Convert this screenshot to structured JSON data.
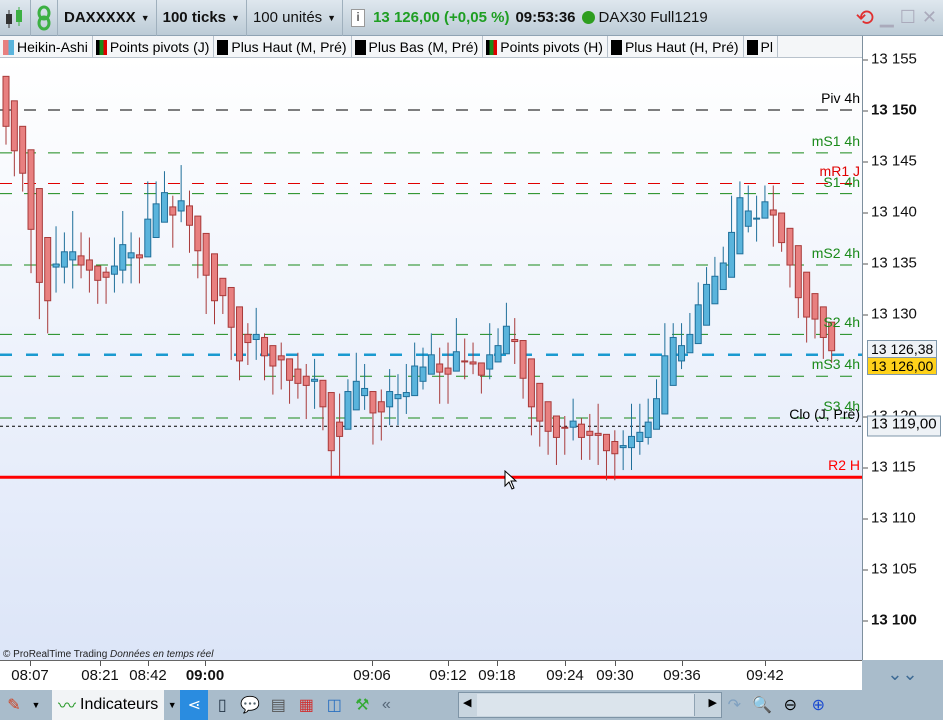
{
  "toolbar": {
    "symbol": "DAXXXXX",
    "period": "100 ticks",
    "units": "100 unités",
    "price_change": "13 126,00 (+0,05 %)",
    "time": "09:53:36",
    "feed": "DAX30 Full1219",
    "status_color": "#2e9e1f",
    "price_color": "#1e9e22"
  },
  "indicators": [
    {
      "label": "Heikin-Ashi",
      "colors": [
        "#e88080",
        "#5ab4dc"
      ]
    },
    {
      "label": "Points pivots (J)",
      "colors": [
        "#000000",
        "#1a8a1a",
        "#e00000"
      ]
    },
    {
      "label": "Plus Haut (M, Pré)",
      "colors": [
        "#000000"
      ]
    },
    {
      "label": "Plus Bas (M, Pré)",
      "colors": [
        "#000000"
      ]
    },
    {
      "label": "Points pivots (H)",
      "colors": [
        "#000000",
        "#1a8a1a",
        "#e00000"
      ]
    },
    {
      "label": "Plus Haut (H, Pré)",
      "colors": [
        "#000000"
      ]
    },
    {
      "label": "Pl",
      "colors": [
        "#000000"
      ]
    }
  ],
  "y_axis": {
    "ticks": [
      {
        "label": "13 155",
        "value": 13155,
        "bold": false
      },
      {
        "label": "13 150",
        "value": 13150,
        "bold": true
      },
      {
        "label": "13 145",
        "value": 13145,
        "bold": false
      },
      {
        "label": "13 140",
        "value": 13140,
        "bold": false
      },
      {
        "label": "13 135",
        "value": 13135,
        "bold": false
      },
      {
        "label": "13 130",
        "value": 13130,
        "bold": false
      },
      {
        "label": "13 120",
        "value": 13120,
        "bold": false
      },
      {
        "label": "13 115",
        "value": 13115,
        "bold": false
      },
      {
        "label": "13 110",
        "value": 13110,
        "bold": false
      },
      {
        "label": "13 105",
        "value": 13105,
        "bold": false
      },
      {
        "label": "13 100",
        "value": 13100,
        "bold": true
      }
    ],
    "last_price_label": "13 126,38",
    "current_price_label": "13 126,00",
    "close_label": "13 119,00"
  },
  "x_axis": {
    "ticks": [
      {
        "label": "08:07",
        "bold": false
      },
      {
        "label": "08:21",
        "bold": false
      },
      {
        "label": "08:42",
        "bold": false
      },
      {
        "label": "09:00",
        "bold": true
      },
      {
        "label": "09:06",
        "bold": false
      },
      {
        "label": "09:12",
        "bold": false
      },
      {
        "label": "09:18",
        "bold": false
      },
      {
        "label": "09:24",
        "bold": false
      },
      {
        "label": "09:30",
        "bold": false
      },
      {
        "label": "09:36",
        "bold": false
      },
      {
        "label": "09:42",
        "bold": false
      }
    ]
  },
  "levels": [
    {
      "label": "Piv 4h",
      "value": 13150,
      "color": "#000000",
      "style": "dashed"
    },
    {
      "label": "mS1 4h",
      "value": 13145.8,
      "color": "#1a8a1a",
      "style": "dashed"
    },
    {
      "label": "mR1 J",
      "value": 13142.8,
      "color": "#e00000",
      "style": "dashed"
    },
    {
      "label": "S1 4h",
      "value": 13141.8,
      "color": "#1a8a1a",
      "style": "dashed"
    },
    {
      "label": "mS2 4h",
      "value": 13134.8,
      "color": "#1a8a1a",
      "style": "dashed"
    },
    {
      "label": "S2 4h",
      "value": 13128.0,
      "color": "#1a8a1a",
      "style": "dashed"
    },
    {
      "label": "",
      "value": 13126.0,
      "color": "#1a9ad0",
      "style": "price"
    },
    {
      "label": "mS3 4h",
      "value": 13123.9,
      "color": "#1a8a1a",
      "style": "dashed"
    },
    {
      "label": "S3 4h",
      "value": 13119.8,
      "color": "#1a8a1a",
      "style": "dashed"
    },
    {
      "label": "Clo (J, Pré)",
      "value": 13119.0,
      "color": "#000000",
      "style": "dotted"
    },
    {
      "label": "R2 H",
      "value": 13114.0,
      "color": "#ff0000",
      "style": "solid"
    }
  ],
  "credit": {
    "brand": "© ProRealTime Trading",
    "note": "Données en temps réel"
  },
  "bottombar": {
    "indicators_label": "Indicateurs"
  },
  "chart_data": {
    "type": "candlestick",
    "style": "Heikin-Ashi",
    "fields": [
      "open",
      "high",
      "low",
      "close"
    ],
    "up_color": "#5ab4dc",
    "down_color": "#e88080",
    "candles": [
      [
        13153.3,
        13153.3,
        13146.6,
        13148.4
      ],
      [
        13150.9,
        13150.9,
        13143.5,
        13146.0
      ],
      [
        13148.4,
        13148.4,
        13142.0,
        13143.8
      ],
      [
        13146.1,
        13146.1,
        13134.0,
        13138.3
      ],
      [
        13142.3,
        13142.3,
        13129.5,
        13133.1
      ],
      [
        13137.5,
        13137.5,
        13128.1,
        13131.3
      ],
      [
        13134.6,
        13138.6,
        13132.1,
        13134.9
      ],
      [
        13134.6,
        13138.0,
        13133.0,
        13136.1
      ],
      [
        13135.3,
        13140.1,
        13132.5,
        13136.1
      ],
      [
        13135.7,
        13138.0,
        13133.5,
        13134.8
      ],
      [
        13135.3,
        13137.5,
        13132.1,
        13134.3
      ],
      [
        13134.7,
        13134.7,
        13131.0,
        13133.3
      ],
      [
        13134.1,
        13134.6,
        13131.0,
        13133.6
      ],
      [
        13133.9,
        13137.5,
        13132.1,
        13134.7
      ],
      [
        13134.3,
        13140.1,
        13133.0,
        13136.8
      ],
      [
        13135.5,
        13138.0,
        13133.0,
        13136.0
      ],
      [
        13135.8,
        13137.5,
        13133.0,
        13135.5
      ],
      [
        13135.6,
        13143.0,
        13135.6,
        13139.3
      ],
      [
        13137.5,
        13143.0,
        13137.5,
        13140.8
      ],
      [
        13139.0,
        13144.0,
        13139.0,
        13141.9
      ],
      [
        13140.5,
        13141.6,
        13136.5,
        13139.7
      ],
      [
        13140.1,
        13144.6,
        13139.0,
        13141.1
      ],
      [
        13140.6,
        13142.1,
        13136.0,
        13138.7
      ],
      [
        13139.6,
        13139.6,
        13133.5,
        13136.2
      ],
      [
        13137.9,
        13137.9,
        13130.0,
        13133.8
      ],
      [
        13135.9,
        13135.9,
        13129.0,
        13131.3
      ],
      [
        13133.5,
        13133.5,
        13130.0,
        13131.8
      ],
      [
        13132.6,
        13132.6,
        13125.5,
        13128.7
      ],
      [
        13130.7,
        13130.7,
        13123.5,
        13125.4
      ],
      [
        13128.0,
        13129.1,
        13125.0,
        13127.2
      ],
      [
        13127.5,
        13130.6,
        13125.5,
        13128.0
      ],
      [
        13127.7,
        13128.1,
        13123.5,
        13125.9
      ],
      [
        13126.9,
        13126.9,
        13122.1,
        13124.9
      ],
      [
        13125.9,
        13127.2,
        13122.6,
        13125.5
      ],
      [
        13125.6,
        13125.6,
        13121.2,
        13123.5
      ],
      [
        13124.6,
        13126.2,
        13121.7,
        13123.2
      ],
      [
        13123.9,
        13125.1,
        13119.7,
        13123.0
      ],
      [
        13123.4,
        13125.6,
        13120.7,
        13123.6
      ],
      [
        13123.5,
        13123.5,
        13118.6,
        13120.9
      ],
      [
        13122.3,
        13122.3,
        13114.1,
        13116.6
      ],
      [
        13119.4,
        13122.2,
        13114.1,
        13118.0
      ],
      [
        13118.7,
        13123.6,
        13118.7,
        13122.4
      ],
      [
        13120.6,
        13126.2,
        13120.6,
        13123.4
      ],
      [
        13122.0,
        13125.1,
        13120.6,
        13122.7
      ],
      [
        13122.4,
        13122.4,
        13117.2,
        13120.3
      ],
      [
        13121.4,
        13122.6,
        13117.6,
        13120.4
      ],
      [
        13120.9,
        13124.6,
        13119.1,
        13122.4
      ],
      [
        13121.7,
        13124.1,
        13119.1,
        13122.1
      ],
      [
        13121.9,
        13125.1,
        13120.2,
        13122.3
      ],
      [
        13122.0,
        13127.2,
        13122.0,
        13124.9
      ],
      [
        13123.4,
        13126.7,
        13122.6,
        13124.8
      ],
      [
        13124.1,
        13128.1,
        13124.1,
        13126.0
      ],
      [
        13125.1,
        13126.7,
        13121.2,
        13124.3
      ],
      [
        13124.7,
        13127.2,
        13121.2,
        13124.1
      ],
      [
        13124.4,
        13129.6,
        13124.4,
        13126.3
      ],
      [
        13125.4,
        13127.6,
        13123.6,
        13125.3
      ],
      [
        13125.3,
        13127.2,
        13124.1,
        13125.1
      ],
      [
        13125.2,
        13125.2,
        13122.2,
        13124.0
      ],
      [
        13124.6,
        13129.1,
        13123.6,
        13126.0
      ],
      [
        13125.3,
        13128.6,
        13125.3,
        13126.9
      ],
      [
        13126.1,
        13131.1,
        13126.1,
        13128.8
      ],
      [
        13127.5,
        13129.6,
        13125.1,
        13127.3
      ],
      [
        13127.4,
        13127.4,
        13121.7,
        13123.7
      ],
      [
        13125.6,
        13125.6,
        13118.1,
        13120.9
      ],
      [
        13123.2,
        13123.2,
        13117.0,
        13119.5
      ],
      [
        13121.4,
        13121.4,
        13116.2,
        13118.5
      ],
      [
        13120.0,
        13120.0,
        13115.2,
        13117.9
      ],
      [
        13118.9,
        13120.0,
        13116.2,
        13118.8
      ],
      [
        13118.9,
        13121.7,
        13117.6,
        13119.5
      ],
      [
        13119.2,
        13119.8,
        13115.7,
        13117.9
      ],
      [
        13118.5,
        13120.2,
        13115.7,
        13118.1
      ],
      [
        13118.3,
        13121.2,
        13115.2,
        13118.1
      ],
      [
        13118.2,
        13118.2,
        13113.7,
        13116.6
      ],
      [
        13117.5,
        13118.6,
        13113.7,
        13116.3
      ],
      [
        13116.9,
        13118.6,
        13114.7,
        13117.1
      ],
      [
        13116.9,
        13121.2,
        13114.7,
        13118.0
      ],
      [
        13117.5,
        13121.2,
        13116.2,
        13118.4
      ],
      [
        13117.9,
        13121.7,
        13117.2,
        13119.4
      ],
      [
        13118.7,
        13123.6,
        13118.7,
        13121.7
      ],
      [
        13120.2,
        13129.1,
        13120.2,
        13125.9
      ],
      [
        13123.0,
        13129.1,
        13123.0,
        13127.7
      ],
      [
        13125.4,
        13129.1,
        13124.6,
        13126.9
      ],
      [
        13126.2,
        13130.1,
        13126.2,
        13128.0
      ],
      [
        13127.1,
        13133.1,
        13127.1,
        13130.9
      ],
      [
        13128.9,
        13134.6,
        13128.9,
        13132.9
      ],
      [
        13131.0,
        13135.6,
        13131.0,
        13133.7
      ],
      [
        13132.4,
        13136.6,
        13132.4,
        13135.0
      ],
      [
        13133.6,
        13141.6,
        13133.6,
        13138.0
      ],
      [
        13135.9,
        13143.0,
        13135.9,
        13141.4
      ],
      [
        13138.6,
        13142.6,
        13138.0,
        13140.1
      ],
      [
        13139.3,
        13141.6,
        13137.1,
        13139.4
      ],
      [
        13139.4,
        13142.6,
        13139.4,
        13141.0
      ],
      [
        13140.2,
        13142.6,
        13136.6,
        13139.7
      ],
      [
        13139.9,
        13139.9,
        13136.1,
        13137.0
      ],
      [
        13138.4,
        13138.4,
        13132.6,
        13134.8
      ],
      [
        13136.7,
        13136.7,
        13129.6,
        13131.6
      ],
      [
        13134.1,
        13134.1,
        13127.2,
        13129.7
      ],
      [
        13132.0,
        13132.0,
        13127.6,
        13129.5
      ],
      [
        13130.7,
        13130.7,
        13125.6,
        13127.7
      ],
      [
        13129.2,
        13129.2,
        13125.2,
        13126.4
      ]
    ]
  }
}
